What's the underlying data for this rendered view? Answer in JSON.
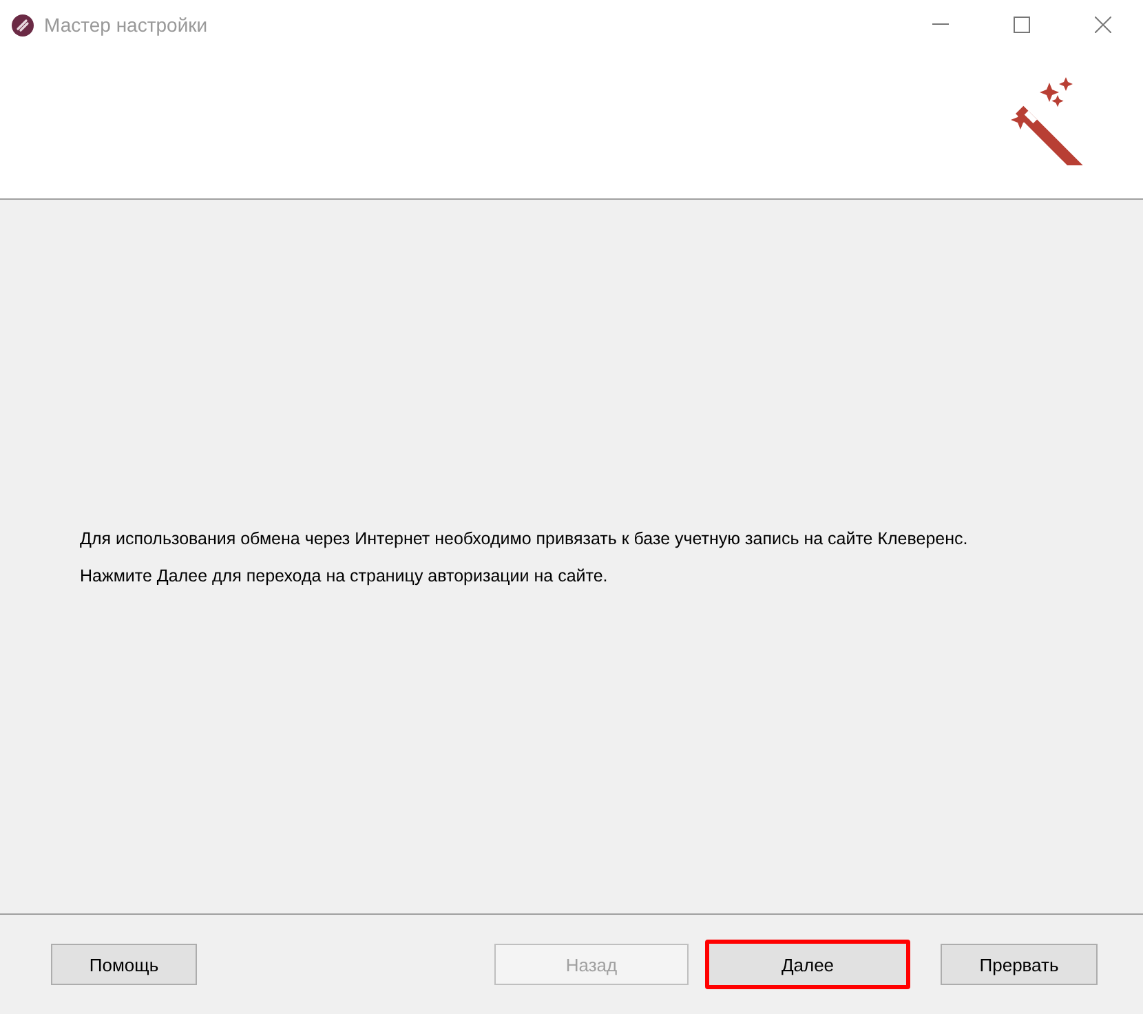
{
  "window": {
    "title": "Мастер настройки"
  },
  "body": {
    "paragraphs": [
      "Для использования обмена через Интернет необходимо привязать к базе учетную запись на сайте Клеверенс.",
      "Нажмите Далее для перехода на страницу авторизации на сайте."
    ]
  },
  "left_buttons": [
    {
      "label": "Помощь",
      "disabled": false,
      "highlighted": false
    }
  ],
  "right_buttons": [
    {
      "label": "Назад",
      "disabled": true,
      "highlighted": false
    },
    {
      "label": "Далее",
      "disabled": false,
      "highlighted": true
    },
    {
      "label": "Прервать",
      "disabled": false,
      "highlighted": false
    }
  ]
}
